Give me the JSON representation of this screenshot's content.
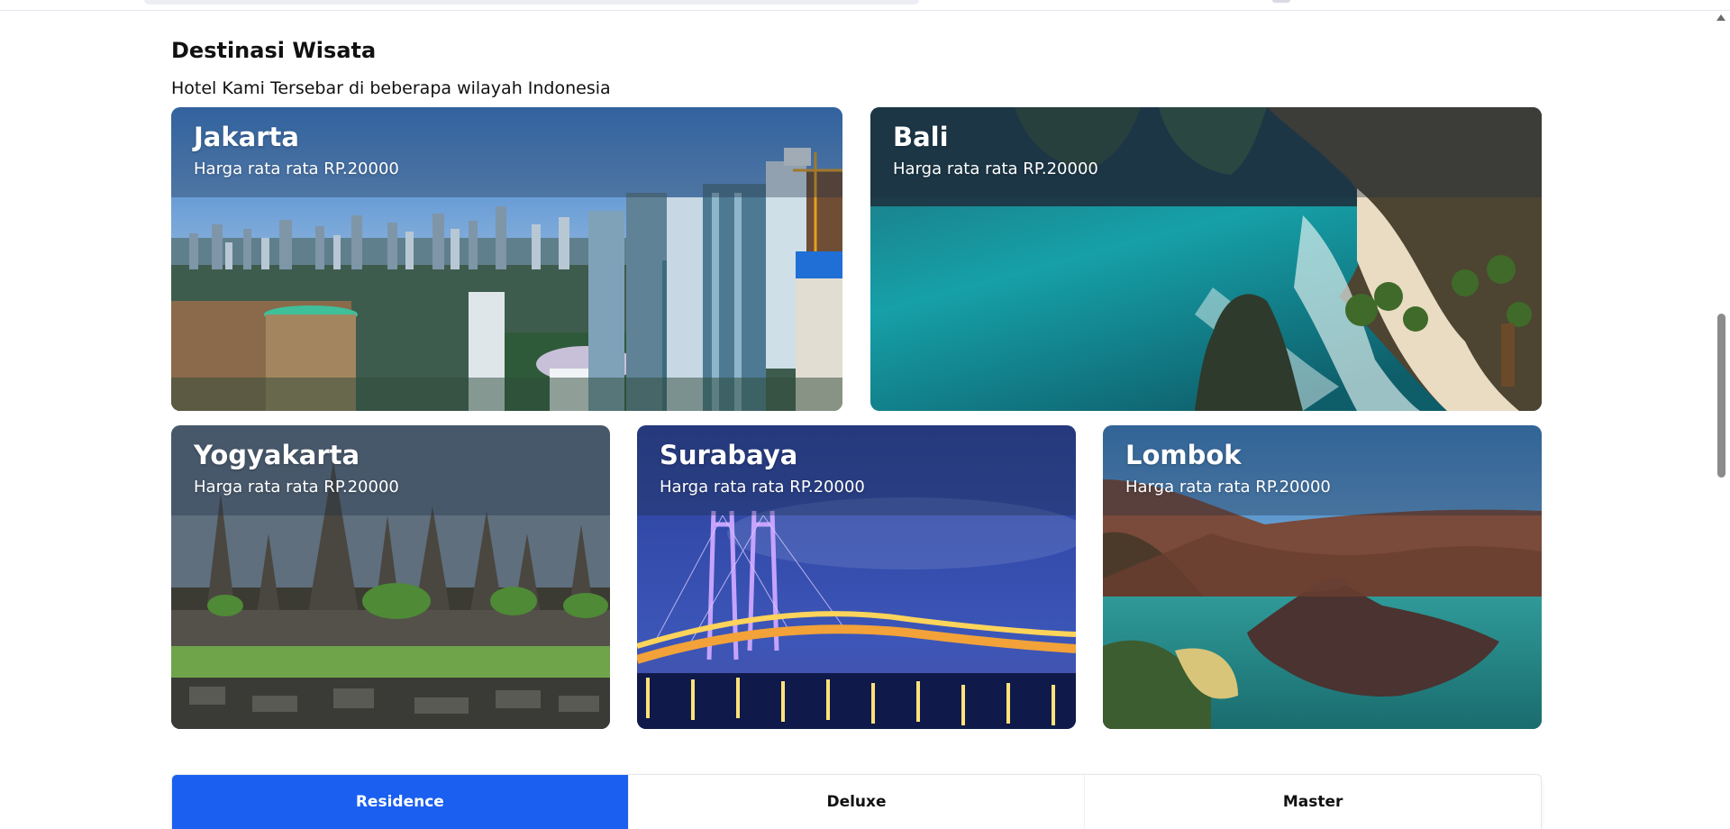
{
  "section": {
    "title": "Destinasi Wisata",
    "subtitle": "Hotel Kami Tersebar di beberapa wilayah Indonesia"
  },
  "destinations": [
    {
      "name": "Jakarta",
      "price": "Harga rata rata RP.20000",
      "image": "jakarta-skyline"
    },
    {
      "name": "Bali",
      "price": "Harga rata rata RP.20000",
      "image": "bali-coast"
    },
    {
      "name": "Yogyakarta",
      "price": "Harga rata rata RP.20000",
      "image": "prambanan-temple"
    },
    {
      "name": "Surabaya",
      "price": "Harga rata rata RP.20000",
      "image": "suramadu-bridge"
    },
    {
      "name": "Lombok",
      "price": "Harga rata rata RP.20000",
      "image": "rinjani-volcano"
    }
  ],
  "tabs": [
    {
      "label": "Residence",
      "active": true
    },
    {
      "label": "Deluxe",
      "active": false
    },
    {
      "label": "Master",
      "active": false
    }
  ],
  "colors": {
    "accent": "#1a5ff0",
    "overlay": "rgba(30,45,70,0.35)"
  }
}
